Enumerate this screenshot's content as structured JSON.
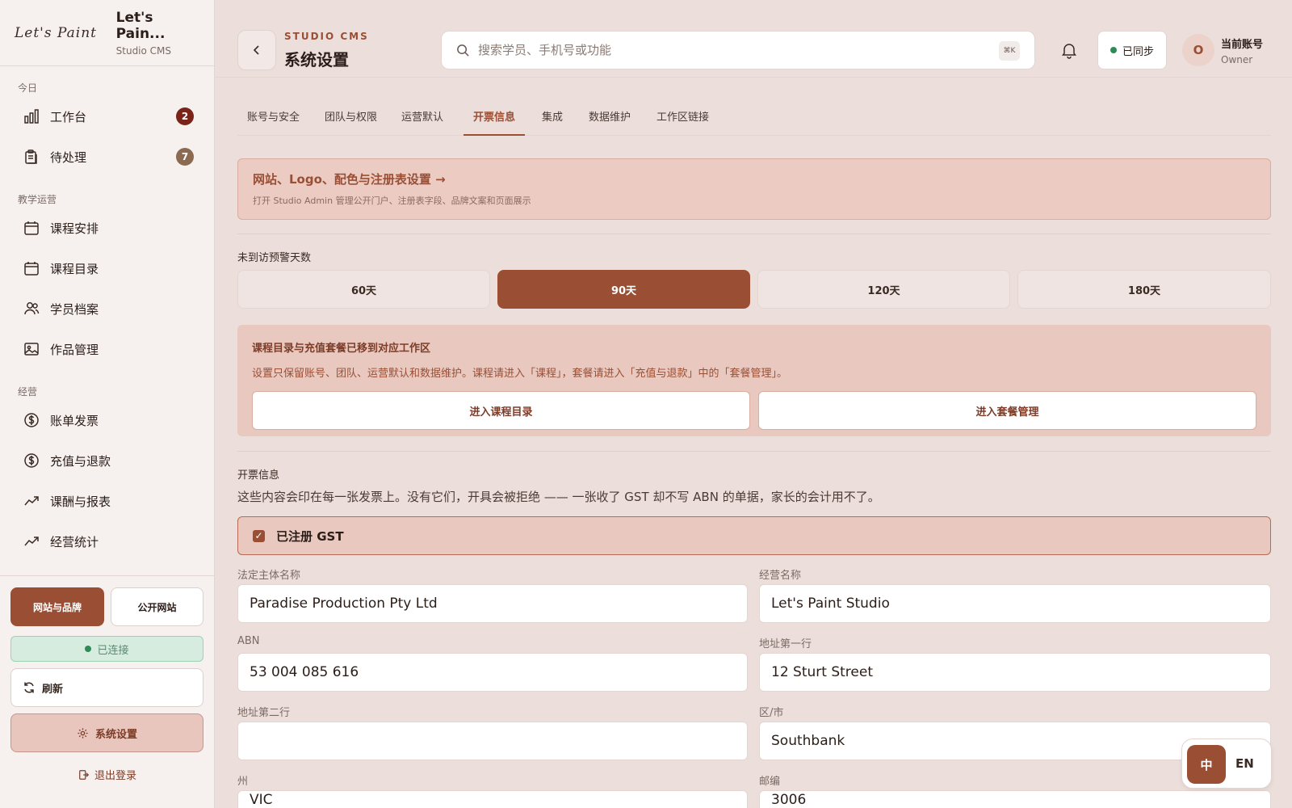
{
  "brand": {
    "logo_text": "Let's Paint",
    "name": "Let's Pain...",
    "sub": "Studio CMS"
  },
  "sidebar": {
    "sections": [
      "今日",
      "教学运营",
      "经营"
    ],
    "items": [
      {
        "label": "工作台",
        "icon": "bar-chart-icon",
        "badge": "2"
      },
      {
        "label": "待处理",
        "icon": "clipboard-icon",
        "badge": "7"
      },
      {
        "label": "课程安排",
        "icon": "calendar-icon"
      },
      {
        "label": "课程目录",
        "icon": "calendar-icon"
      },
      {
        "label": "学员档案",
        "icon": "users-icon"
      },
      {
        "label": "作品管理",
        "icon": "image-icon"
      },
      {
        "label": "账单发票",
        "icon": "dollar-icon"
      },
      {
        "label": "充值与退款",
        "icon": "dollar-icon"
      },
      {
        "label": "课酬与报表",
        "icon": "trend-icon"
      },
      {
        "label": "经营统计",
        "icon": "trend-icon"
      }
    ],
    "footer": {
      "site_brand": "网站与品牌",
      "public_site": "公开网站",
      "connected": "已连接",
      "refresh": "刷新",
      "settings": "系统设置",
      "logout": "退出登录"
    }
  },
  "header": {
    "eyebrow": "STUDIO CMS",
    "title": "系统设置",
    "search_placeholder": "搜索学员、手机号或功能",
    "shortcut": "⌘K",
    "sync": "已同步",
    "avatar_initial": "O",
    "account_name": "当前账号",
    "account_role": "Owner"
  },
  "tabs": [
    "账号与安全",
    "团队与权限",
    "运营默认",
    "开票信息",
    "集成",
    "数据维护",
    "工作区链接"
  ],
  "active_tab": "开票信息",
  "banner": {
    "title": "网站、Logo、配色与注册表设置 →",
    "sub": "打开 Studio Admin 管理公开门户、注册表字段、品牌文案和页面展示"
  },
  "alert_days": {
    "label": "未到访预警天数",
    "options": [
      "60天",
      "90天",
      "120天",
      "180天"
    ],
    "selected": "90天"
  },
  "notice": {
    "title": "课程目录与充值套餐已移到对应工作区",
    "text": "设置只保留账号、团队、运营默认和数据维护。课程请进入「课程」，套餐请进入「充值与退款」中的「套餐管理」。",
    "btn_courses": "进入课程目录",
    "btn_packages": "进入套餐管理"
  },
  "invoice": {
    "section_label": "开票信息",
    "description": "这些内容会印在每一张发票上。没有它们，开具会被拒绝 —— 一张收了 GST 却不写 ABN 的单据，家长的会计用不了。",
    "gst_label": "已注册 GST",
    "gst_checked": true,
    "fields": {
      "legal_name": {
        "label": "法定主体名称",
        "value": "Paradise Production Pty Ltd"
      },
      "trading_name": {
        "label": "经营名称",
        "value": "Let's Paint Studio"
      },
      "abn": {
        "label": "ABN",
        "value": "53 004 085 616"
      },
      "address1": {
        "label": "地址第一行",
        "value": "12 Sturt Street"
      },
      "address2": {
        "label": "地址第二行",
        "value": ""
      },
      "suburb": {
        "label": "区/市",
        "value": "Southbank"
      },
      "state": {
        "label": "州",
        "value": "VIC"
      },
      "postcode": {
        "label": "邮编",
        "value": "3006"
      }
    }
  },
  "lang": {
    "zh": "中",
    "en": "EN"
  },
  "colors": {
    "accent": "#9a4f35",
    "badge_red": "#7a2318",
    "badge_brown": "#8a6a50",
    "success": "#2f8a58"
  }
}
